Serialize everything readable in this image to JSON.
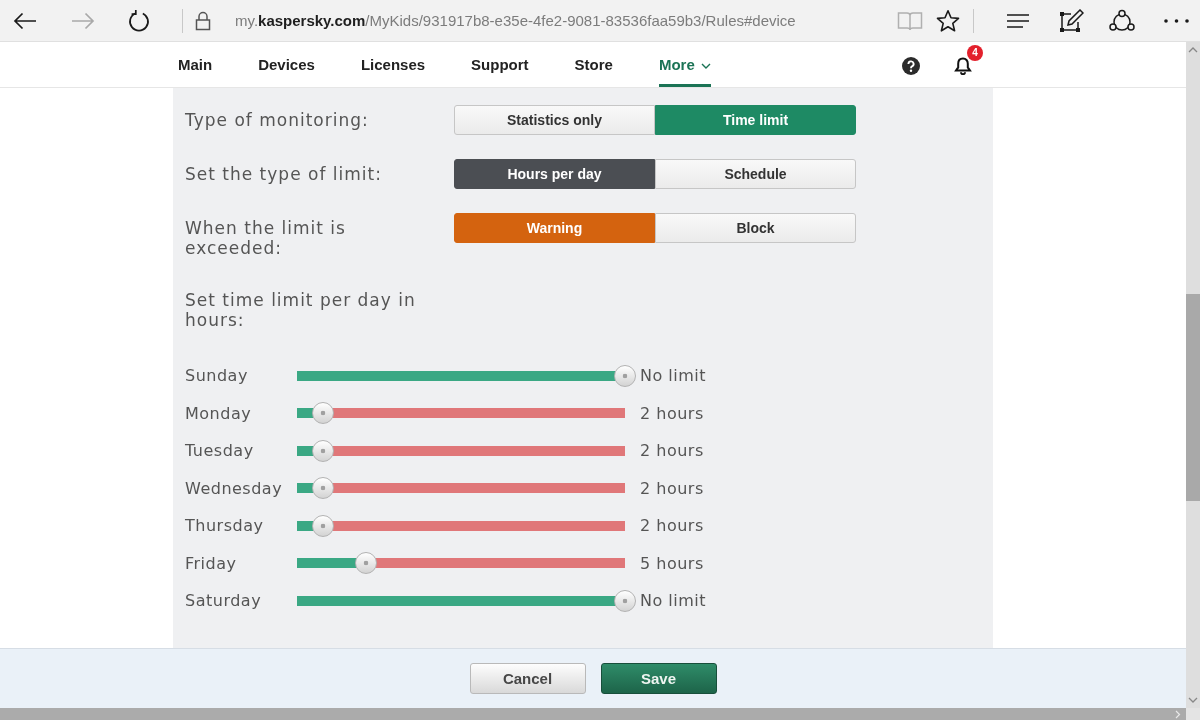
{
  "browser": {
    "forward": {
      "disabled": true
    },
    "url": "my.**kaspersky.com**/MyKids/931917b8-e35e-4fe2-9081-83536faa59b3/Rules#device",
    "reading_view": {
      "disabled": true
    }
  },
  "nav": {
    "items": [
      {
        "label": "Main",
        "kind": "link",
        "selected": false
      },
      {
        "label": "Devices",
        "kind": "link",
        "selected": false
      },
      {
        "label": "Licenses",
        "kind": "link",
        "selected": false
      },
      {
        "label": "Support",
        "kind": "link",
        "selected": false
      },
      {
        "label": "Store",
        "kind": "link",
        "selected": false
      },
      {
        "label": "More",
        "kind": "dropdown",
        "selected": true
      }
    ],
    "notifications": {
      "badge": "4"
    }
  },
  "settings": [
    {
      "label": "Type of monitoring:",
      "color": "#1e8a64",
      "options": [
        {
          "label": "Statistics only",
          "selected": false
        },
        {
          "label": "Time limit",
          "selected": true
        }
      ]
    },
    {
      "label": "Set the type of limit:",
      "color": "#4b4e53",
      "options": [
        {
          "label": "Hours per day",
          "selected": true
        },
        {
          "label": "Schedule",
          "selected": false
        }
      ]
    },
    {
      "label": "When the limit is exceeded:",
      "color": "#d4630f",
      "options": [
        {
          "label": "Warning",
          "selected": true
        },
        {
          "label": "Block",
          "selected": false
        }
      ]
    }
  ],
  "daily_limit": {
    "label": "Set time limit per day in hours:",
    "days": [
      {
        "day": "Sunday",
        "level": 1,
        "reading": "No limit"
      },
      {
        "day": "Monday",
        "level": 0.08,
        "reading": "2 hours"
      },
      {
        "day": "Tuesday",
        "level": 0.08,
        "reading": "2 hours"
      },
      {
        "day": "Wednesday",
        "level": 0.08,
        "reading": "2 hours"
      },
      {
        "day": "Thursday",
        "level": 0.08,
        "reading": "2 hours"
      },
      {
        "day": "Friday",
        "level": 0.21,
        "reading": "5 hours"
      },
      {
        "day": "Saturday",
        "level": 1,
        "reading": "No limit"
      }
    ]
  },
  "buttons": [
    {
      "label": "Cancel",
      "kind": "secondary"
    },
    {
      "label": "Save",
      "kind": "primary"
    }
  ]
}
